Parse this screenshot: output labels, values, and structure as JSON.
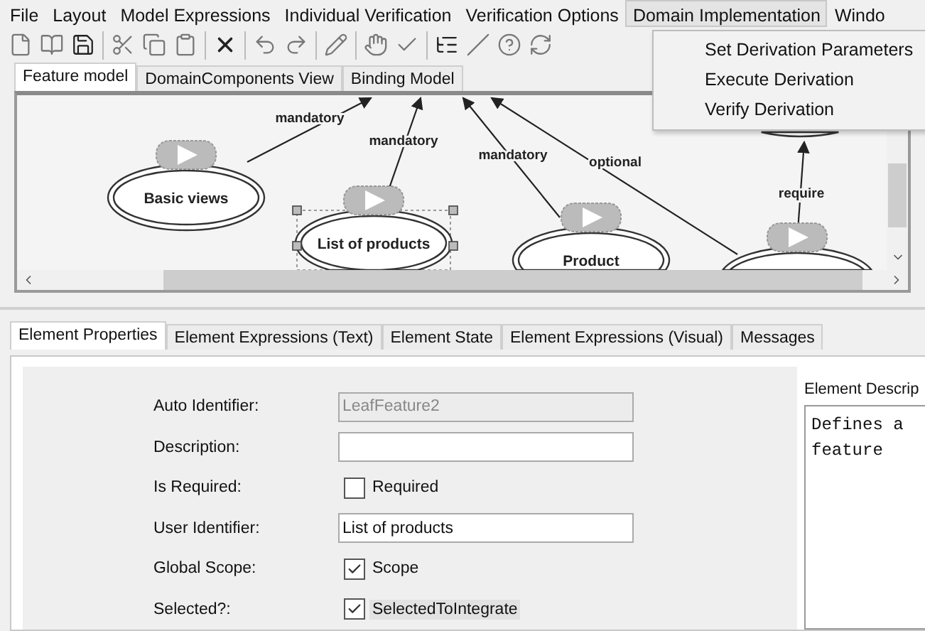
{
  "menu": [
    {
      "label": "File",
      "selected": false
    },
    {
      "label": "Layout",
      "selected": false
    },
    {
      "label": "Model Expressions",
      "selected": false
    },
    {
      "label": "Individual Verification",
      "selected": false
    },
    {
      "label": "Verification Options",
      "selected": false
    },
    {
      "label": "Domain Implementation",
      "selected": true
    },
    {
      "label": "Windo",
      "selected": false
    }
  ],
  "dropdown": [
    "Set Derivation Parameters",
    "Execute Derivation",
    "Verify Derivation"
  ],
  "model_tabs": [
    {
      "label": "Feature model",
      "selected": true
    },
    {
      "label": "DomainComponents View",
      "selected": false
    },
    {
      "label": "Binding Model",
      "selected": false
    }
  ],
  "diagram": {
    "nodes": [
      {
        "label": "Basic views",
        "selected": false
      },
      {
        "label": "List of products",
        "selected": true
      },
      {
        "label": "Product",
        "selected": false
      },
      {
        "selected": false
      },
      {
        "selected": false
      }
    ],
    "edges": [
      {
        "label": "mandatory"
      },
      {
        "label": "mandatory"
      },
      {
        "label": "mandatory"
      },
      {
        "label": "optional"
      },
      {
        "label": "require"
      }
    ]
  },
  "bottom_tabs": [
    {
      "label": "Element Properties",
      "selected": true
    },
    {
      "label": "Element Expressions (Text)",
      "selected": false
    },
    {
      "label": "Element State",
      "selected": false
    },
    {
      "label": "Element Expressions (Visual)",
      "selected": false
    },
    {
      "label": "Messages",
      "selected": false
    }
  ],
  "properties": [
    {
      "kind": "text",
      "label": "Auto Identifier:",
      "value": "LeafFeature2",
      "disabled": true
    },
    {
      "kind": "text",
      "label": "Description:",
      "disabled": false
    },
    {
      "kind": "check",
      "label": "Is Required:",
      "text": "Required",
      "checked": false
    },
    {
      "kind": "text",
      "label": "User Identifier:",
      "value": "List of products",
      "disabled": false
    },
    {
      "kind": "check",
      "label": "Global Scope:",
      "text": "Scope",
      "checked": true
    },
    {
      "kind": "check",
      "label": "Selected?:",
      "text": "SelectedToIntegrate",
      "checked": true
    }
  ],
  "description": {
    "title": "Element Descrip",
    "lines": [
      "Defines a",
      "feature"
    ]
  }
}
